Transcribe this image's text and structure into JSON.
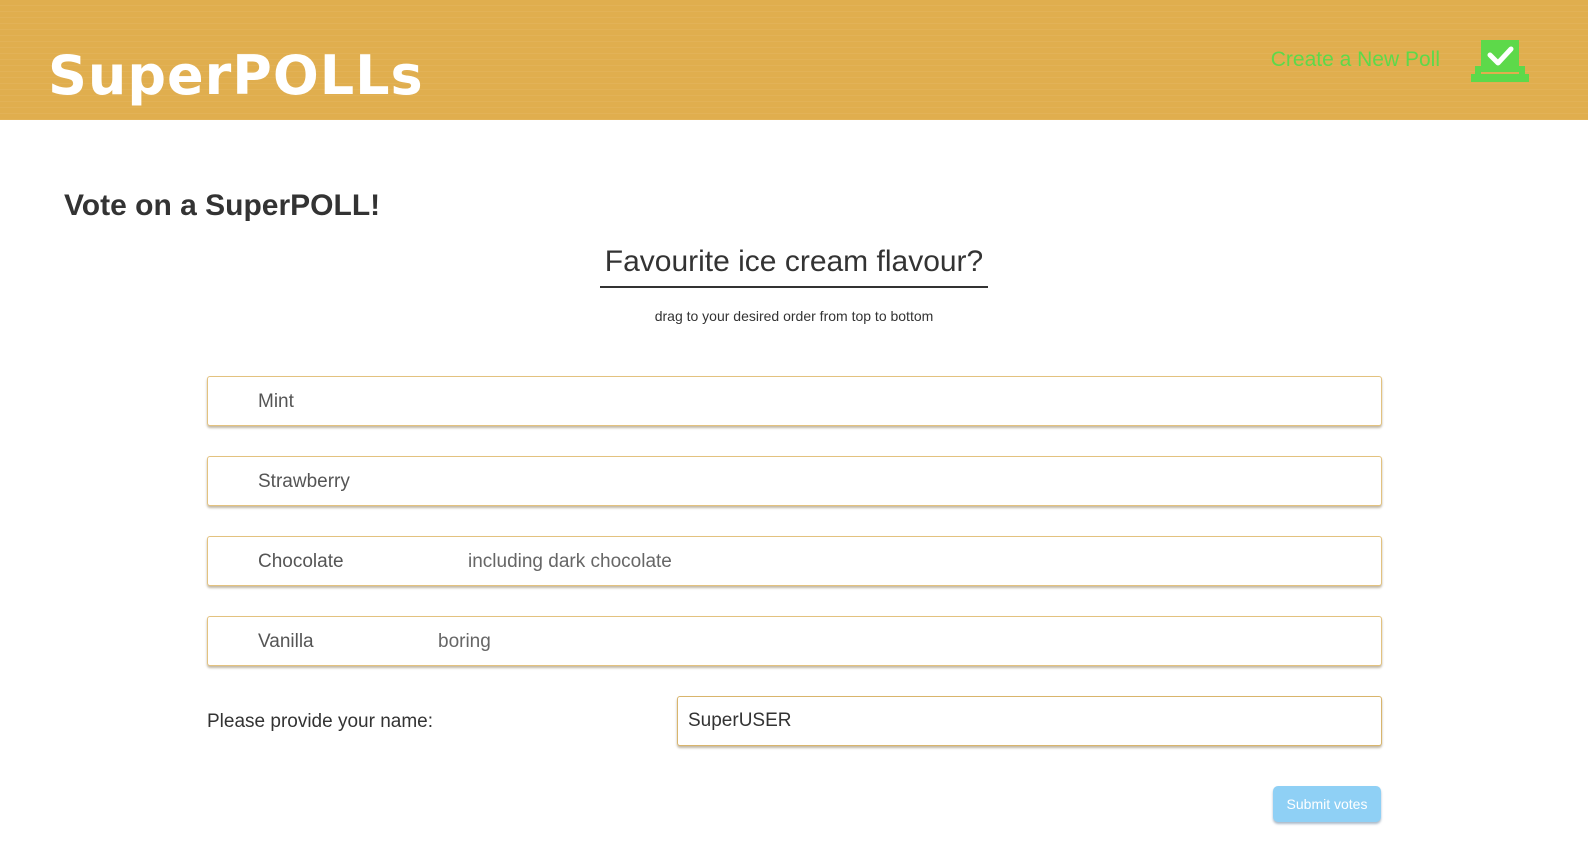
{
  "header": {
    "logo": "SuperPOLLs",
    "nav_link": "Create a New Poll",
    "nav_icon": "ballot-box-check-icon",
    "background_color": "#e0ae4e",
    "link_color": "#5dd94a"
  },
  "main": {
    "page_title": "Vote on a SuperPOLL!",
    "question": "Favourite ice cream flavour?",
    "instructions": "drag to your desired order from top to bottom",
    "options": [
      {
        "name": "Mint",
        "description": ""
      },
      {
        "name": "Strawberry",
        "description": ""
      },
      {
        "name": "Chocolate",
        "description": "including dark chocolate"
      },
      {
        "name": "Vanilla",
        "description": "boring"
      }
    ],
    "name_label": "Please provide your name:",
    "name_value": "SuperUSER",
    "submit_label": "Submit votes",
    "submit_color": "#8fd0f5"
  }
}
